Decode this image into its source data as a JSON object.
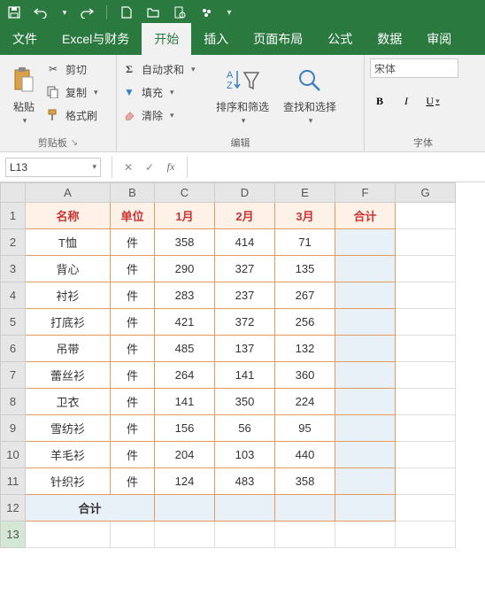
{
  "qat": {
    "dropdown": "▾"
  },
  "menu": {
    "items": [
      "文件",
      "Excel与财务",
      "开始",
      "插入",
      "页面布局",
      "公式",
      "数据",
      "审阅"
    ],
    "active_index": 2
  },
  "ribbon": {
    "clipboard": {
      "label": "剪贴板",
      "paste": "粘贴",
      "cut": "剪切",
      "copy": "复制",
      "format_painter": "格式刷"
    },
    "editing": {
      "label": "编辑",
      "autosum": "自动求和",
      "fill": "填充",
      "clear": "清除",
      "sort_filter": "排序和筛选",
      "find_select": "查找和选择"
    },
    "font": {
      "label": "字体",
      "name": "宋体",
      "bold": "B",
      "italic": "I",
      "underline": "U"
    }
  },
  "namebox": {
    "value": "L13"
  },
  "formula": {
    "fx": "fx",
    "value": ""
  },
  "grid": {
    "col_letters": [
      "A",
      "B",
      "C",
      "D",
      "E",
      "F",
      "G"
    ],
    "row_numbers": [
      "1",
      "2",
      "3",
      "4",
      "5",
      "6",
      "7",
      "8",
      "9",
      "10",
      "11",
      "12",
      "13"
    ],
    "header": [
      "名称",
      "单位",
      "1月",
      "2月",
      "3月",
      "合计"
    ],
    "rows": [
      [
        "T恤",
        "件",
        "358",
        "414",
        "71",
        ""
      ],
      [
        "背心",
        "件",
        "290",
        "327",
        "135",
        ""
      ],
      [
        "衬衫",
        "件",
        "283",
        "237",
        "267",
        ""
      ],
      [
        "打底衫",
        "件",
        "421",
        "372",
        "256",
        ""
      ],
      [
        "吊带",
        "件",
        "485",
        "137",
        "132",
        ""
      ],
      [
        "蕾丝衫",
        "件",
        "264",
        "141",
        "360",
        ""
      ],
      [
        "卫衣",
        "件",
        "141",
        "350",
        "224",
        ""
      ],
      [
        "雪纺衫",
        "件",
        "156",
        "56",
        "95",
        ""
      ],
      [
        "羊毛衫",
        "件",
        "204",
        "103",
        "440",
        ""
      ],
      [
        "针织衫",
        "件",
        "124",
        "483",
        "358",
        ""
      ]
    ],
    "total_label": "合计"
  },
  "chart_data": {
    "type": "table",
    "title": "",
    "columns": [
      "名称",
      "单位",
      "1月",
      "2月",
      "3月",
      "合计"
    ],
    "rows": [
      [
        "T恤",
        "件",
        358,
        414,
        71,
        null
      ],
      [
        "背心",
        "件",
        290,
        327,
        135,
        null
      ],
      [
        "衬衫",
        "件",
        283,
        237,
        267,
        null
      ],
      [
        "打底衫",
        "件",
        421,
        372,
        256,
        null
      ],
      [
        "吊带",
        "件",
        485,
        137,
        132,
        null
      ],
      [
        "蕾丝衫",
        "件",
        264,
        141,
        360,
        null
      ],
      [
        "卫衣",
        "件",
        141,
        350,
        224,
        null
      ],
      [
        "雪纺衫",
        "件",
        156,
        56,
        95,
        null
      ],
      [
        "羊毛衫",
        "件",
        204,
        103,
        440,
        null
      ],
      [
        "针织衫",
        "件",
        124,
        483,
        358,
        null
      ],
      [
        "合计",
        null,
        null,
        null,
        null,
        null
      ]
    ]
  }
}
